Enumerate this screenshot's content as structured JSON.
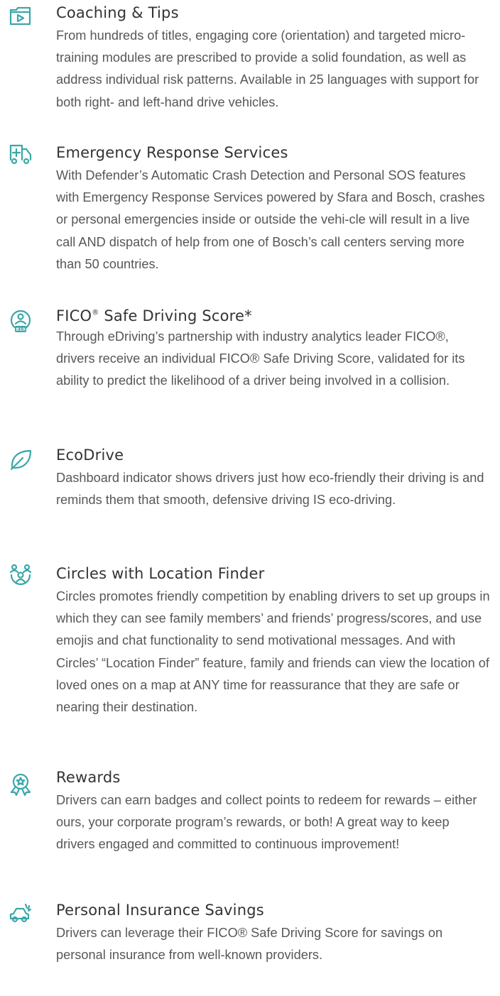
{
  "features": [
    {
      "icon": "video-play-icon",
      "title": "Coaching & Tips",
      "desc": "From hundreds of titles, engaging core (orientation) and targeted micro-training modules are prescribed to provide a solid foundation, as well as address individual risk patterns. Available in 25 languages with support for both right- and left-hand drive vehicles."
    },
    {
      "icon": "ambulance-icon",
      "title": "Emergency Response Services",
      "desc": "With Defender’s Automatic Crash Detection and Personal SOS features with Emergency Response Services powered by Sfara and Bosch, crashes or personal emergencies inside or outside the vehi-cle will result in a live call AND dispatch of help from one of Bosch’s call centers serving more than 50 countries."
    },
    {
      "icon": "driver-score-icon",
      "icon_label": "810",
      "title_main": "FICO",
      "title_reg": "®",
      "title_rest": " Safe Driving Score*",
      "desc": "Through eDriving’s partnership with industry analytics leader FICO®, drivers receive an individual FICO® Safe Driving Score, validated for its ability to predict the likelihood of a driver being involved in a collision."
    },
    {
      "icon": "leaf-icon",
      "title": "EcoDrive",
      "desc": "Dashboard indicator shows drivers just how eco-friendly their driving is and reminds them that smooth, defensive driving IS eco-driving."
    },
    {
      "icon": "group-circle-icon",
      "title": "Circles with Location Finder",
      "desc": "Circles promotes friendly competition by enabling drivers to set up groups in which they can see family members’ and friends’ progress/scores, and use emojis and chat functionality to send motivational messages. And with Circles’ “Location Finder” feature, family and friends can view the location of loved ones on a map at ANY time for reassurance that they are safe or nearing their destination."
    },
    {
      "icon": "award-badge-icon",
      "title": "Rewards",
      "desc": "Drivers can earn badges and collect points to redeem for rewards – either ours, your corporate program’s rewards, or both! A great way to keep drivers engaged and committed to continuous improvement!"
    },
    {
      "icon": "car-crash-icon",
      "title": "Personal Insurance Savings",
      "desc": "Drivers can leverage their FICO® Safe Driving Score for savings on personal insurance from well-known providers."
    }
  ],
  "colors": {
    "accent": "#3aa7a8",
    "title": "#333333",
    "body": "#575757"
  }
}
